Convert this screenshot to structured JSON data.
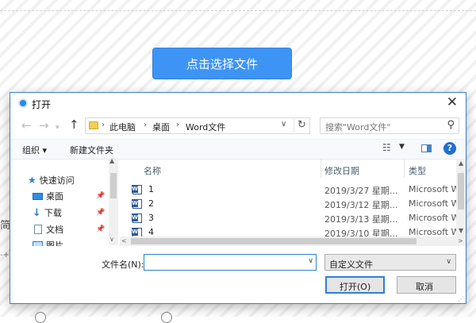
{
  "page": {
    "upload_button": "点击选择文件",
    "left_text_1": "简",
    "left_text_2": "-+",
    "radio_1": "",
    "radio_2": ""
  },
  "dialog": {
    "title": "打开",
    "close": "✕",
    "breadcrumb": [
      "此电脑",
      "桌面",
      "Word文件"
    ],
    "search_placeholder": "搜索\"Word文件\"",
    "toolbar": {
      "organize": "组织 ▾",
      "new_folder": "新建文件夹"
    },
    "nav_items": [
      {
        "label": "快速访问",
        "icon": "star-icon"
      },
      {
        "label": "桌面",
        "icon": "desktop-icon",
        "pinned": true
      },
      {
        "label": "下载",
        "icon": "download-icon",
        "pinned": true
      },
      {
        "label": "文档",
        "icon": "document-icon",
        "pinned": true
      },
      {
        "label": "图片",
        "icon": "picture-icon",
        "pinned": true
      }
    ],
    "columns": {
      "name": "名称",
      "date": "修改日期",
      "type": "类型"
    },
    "files": [
      {
        "name": "1",
        "date": "2019/3/27 星期...",
        "type": "Microsoft Wo"
      },
      {
        "name": "2",
        "date": "2019/3/12 星期...",
        "type": "Microsoft Wo"
      },
      {
        "name": "3",
        "date": "2019/3/13 星期...",
        "type": "Microsoft Wo"
      },
      {
        "name": "4",
        "date": "2019/3/10 星期...",
        "type": "Microsoft Wo"
      }
    ],
    "filename_label": "文件名(N):",
    "filename_value": "",
    "filetype": "自定义文件",
    "open_button": "打开(O)",
    "cancel_button": "取消"
  },
  "colors": {
    "upload_button": "#3e94f5",
    "dialog_border": "#3c7fd3",
    "help_icon": "#1f6fd1"
  }
}
